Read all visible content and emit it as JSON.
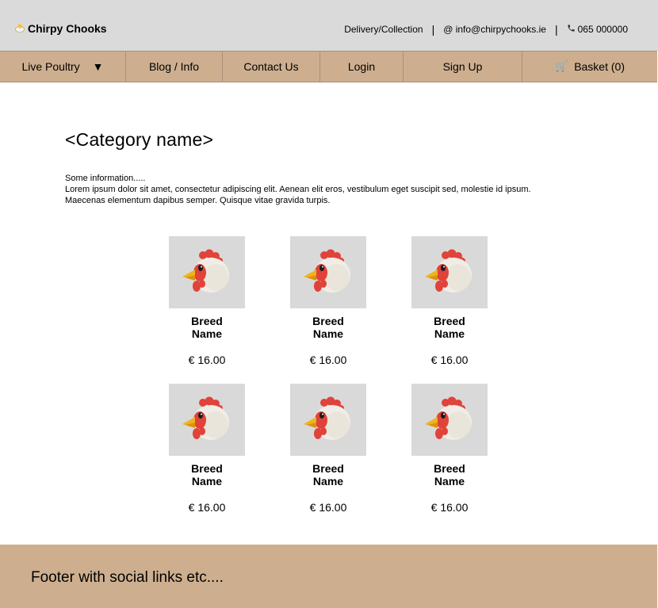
{
  "header": {
    "brand": "Chirpy Chooks",
    "delivery": "Delivery/Collection",
    "email": "@ info@chirpychooks.ie",
    "phone": "065 000000"
  },
  "nav": {
    "items": [
      {
        "label": "Live Poultry"
      },
      {
        "label": "Blog / Info"
      },
      {
        "label": "Contact Us"
      },
      {
        "label": "Login"
      },
      {
        "label": "Sign Up"
      },
      {
        "label": "Basket (0)"
      }
    ]
  },
  "main": {
    "title": "<Category name>",
    "info_lines": [
      "Some information.....",
      "Lorem ipsum dolor sit amet, consectetur adipiscing elit. Aenean elit eros, vestibulum eget suscipit sed, molestie id ipsum.",
      "Maecenas elementum dapibus semper. Quisque vitae gravida turpis."
    ],
    "products": [
      {
        "name_line1": "Breed",
        "name_line2": "Name",
        "price": "€ 16.00"
      },
      {
        "name_line1": "Breed",
        "name_line2": "Name",
        "price": "€ 16.00"
      },
      {
        "name_line1": "Breed",
        "name_line2": "Name",
        "price": "€ 16.00"
      },
      {
        "name_line1": "Breed",
        "name_line2": "Name",
        "price": "€ 16.00"
      },
      {
        "name_line1": "Breed",
        "name_line2": "Name",
        "price": "€ 16.00"
      },
      {
        "name_line1": "Breed",
        "name_line2": "Name",
        "price": "€ 16.00"
      }
    ]
  },
  "footer": {
    "text": "Footer with social links etc...."
  }
}
